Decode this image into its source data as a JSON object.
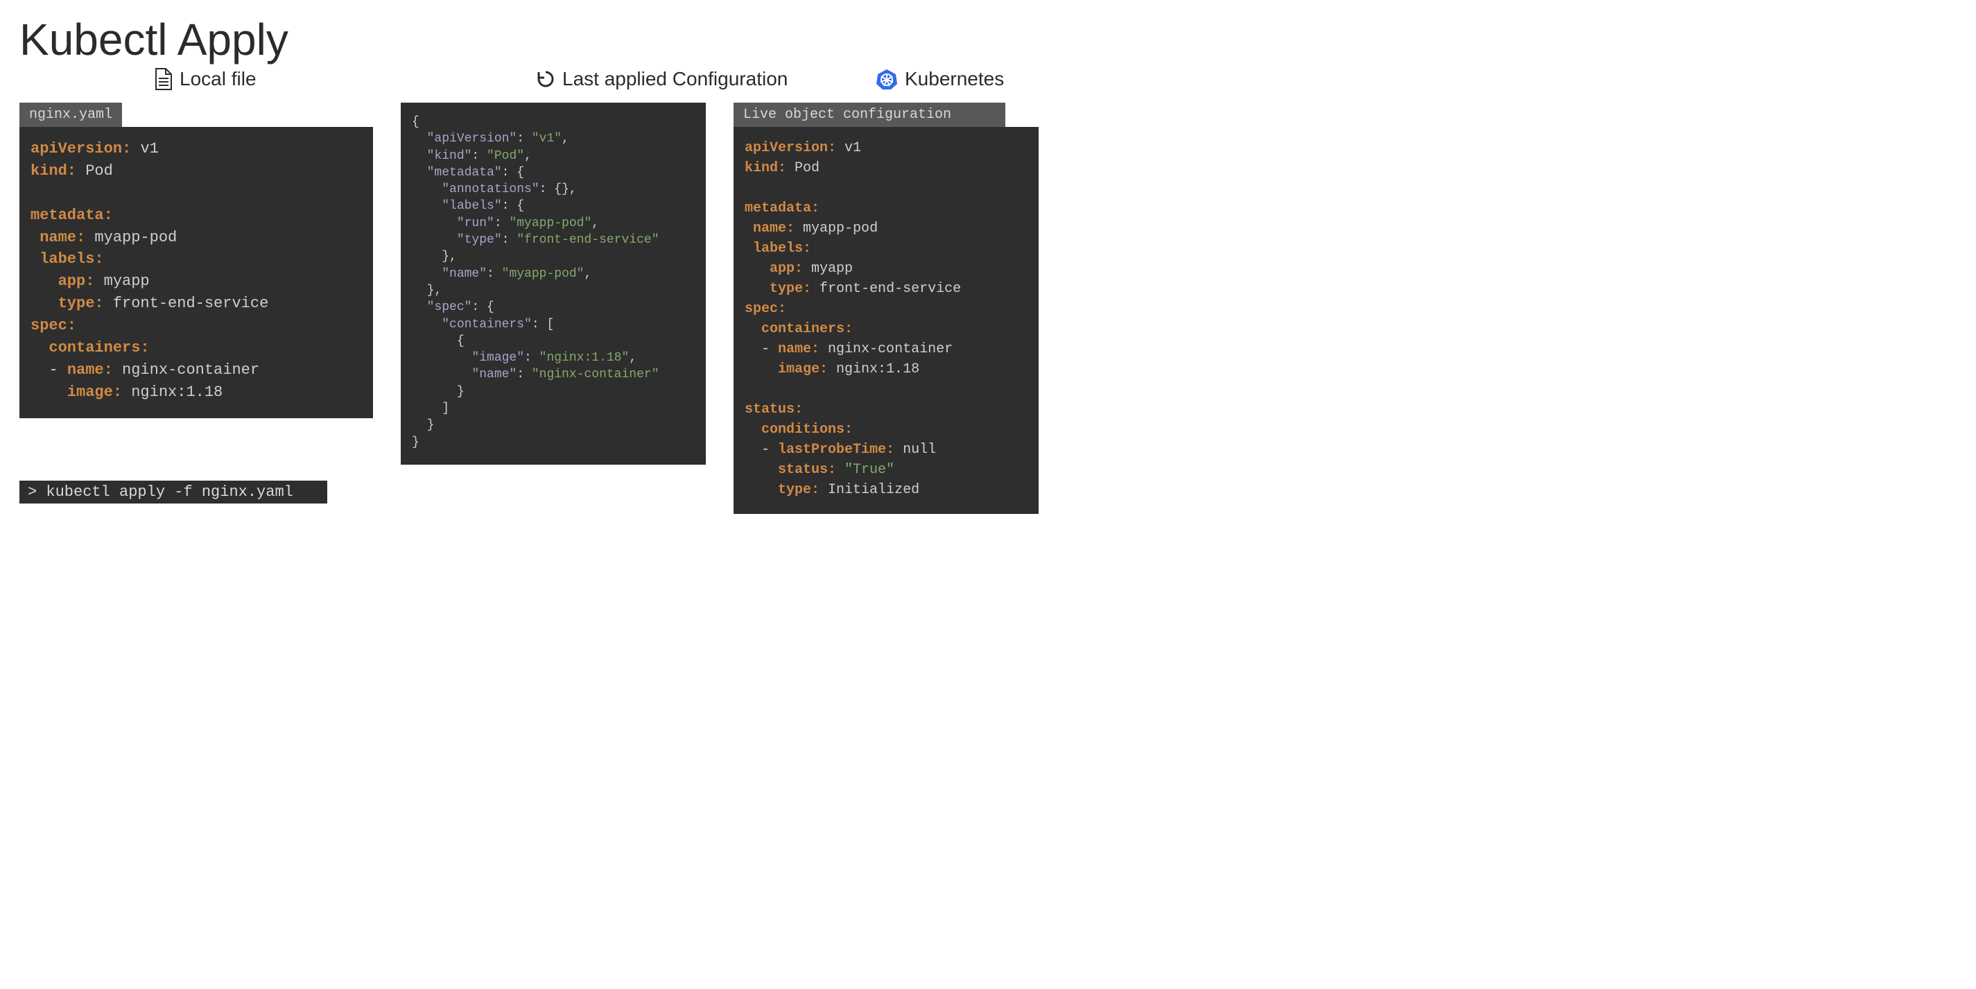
{
  "title": "Kubectl Apply",
  "columns": {
    "local": "Local file",
    "last": "Last applied Configuration",
    "k8s": "Kubernetes"
  },
  "left": {
    "tab": "nginx.yaml",
    "yaml": {
      "apiVersion": "v1",
      "kind": "Pod",
      "metadata": {
        "name": "myapp-pod",
        "labels": {
          "app": "myapp",
          "type": "front-end-service"
        }
      },
      "spec": {
        "containers": [
          {
            "name": "nginx-container",
            "image": "nginx:1.18"
          }
        ]
      }
    }
  },
  "mid": {
    "json": {
      "apiVersion": "v1",
      "kind": "Pod",
      "metadata": {
        "annotations_repr": "{}",
        "labels": {
          "run": "myapp-pod",
          "type": "front-end-service"
        },
        "name": "myapp-pod"
      },
      "spec": {
        "containers": [
          {
            "image": "nginx:1.18",
            "name": "nginx-container"
          }
        ]
      }
    }
  },
  "right": {
    "tab": "Live object configuration",
    "yaml": {
      "apiVersion": "v1",
      "kind": "Pod",
      "metadata": {
        "name": "myapp-pod",
        "labels": {
          "app": "myapp",
          "type": "front-end-service"
        }
      },
      "spec": {
        "containers": [
          {
            "name": "nginx-container",
            "image": "nginx:1.18"
          }
        ]
      },
      "status": {
        "conditions": [
          {
            "lastProbeTime": "null",
            "status": "\"True\"",
            "type": "Initialized"
          }
        ]
      }
    }
  },
  "command": {
    "prompt": ">",
    "text": "kubectl apply -f nginx.yaml"
  }
}
